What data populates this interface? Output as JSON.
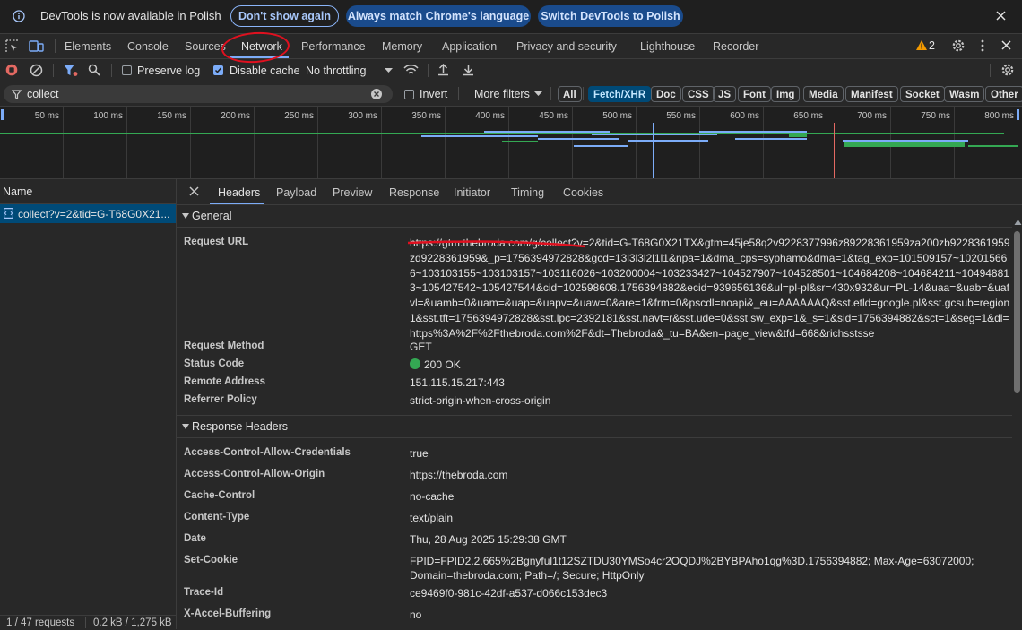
{
  "infobar": {
    "message": "DevTools is now available in Polish",
    "dont_show": "Don't show again",
    "always_match": "Always match Chrome's language",
    "switch_polish": "Switch DevTools to Polish"
  },
  "tabs": [
    "Elements",
    "Console",
    "Sources",
    "Network",
    "Performance",
    "Memory",
    "Application",
    "Privacy and security",
    "Lighthouse",
    "Recorder"
  ],
  "active_tab": "Network",
  "warning_count": "2",
  "toolbar": {
    "preserve_log": "Preserve log",
    "disable_cache": "Disable cache",
    "throttling": "No throttling"
  },
  "filter": {
    "value": "collect",
    "invert": "Invert",
    "more_filters": "More filters",
    "types": [
      "All",
      "Fetch/XHR",
      "Doc",
      "CSS",
      "JS",
      "Font",
      "Img",
      "Media",
      "Manifest",
      "Socket",
      "Wasm",
      "Other"
    ],
    "selected": "Fetch/XHR"
  },
  "timeline": {
    "ticks": [
      "50 ms",
      "100 ms",
      "150 ms",
      "200 ms",
      "250 ms",
      "300 ms",
      "350 ms",
      "400 ms",
      "450 ms",
      "500 ms",
      "550 ms",
      "600 ms",
      "650 ms",
      "700 ms",
      "750 ms",
      "800 ms"
    ]
  },
  "request_list": {
    "header": "Name",
    "item": "collect?v=2&tid=G-T68G0X21...",
    "summary_requests": "1 / 47 requests",
    "summary_size": "0.2 kB / 1,275 kB"
  },
  "detail_tabs": [
    "Headers",
    "Payload",
    "Preview",
    "Response",
    "Initiator",
    "Timing",
    "Cookies"
  ],
  "general": {
    "title": "General",
    "request_url_label": "Request URL",
    "request_url": "https://gtm.thebroda.com/g/collect?v=2&tid=G-T68G0X21TX&gtm=45je58q2v9228377996z89228361959za200zb9228361959zd9228361959&_p=1756394972828&gcd=13l3l3l2l1l1&npa=1&dma_cps=syphamo&dma=1&tag_exp=101509157~102015666~103103155~103103157~103116026~103200004~103233427~104527907~104528501~104684208~104684211~104948813~105427542~105427544&cid=102598608.1756394882&ecid=939656136&ul=pl-pl&sr=430x932&ur=PL-14&uaa=&uab=&uafvl=&uamb=0&uam=&uap=&uapv=&uaw=0&are=1&frm=0&pscdl=noapi&_eu=AAAAAAQ&sst.etld=google.pl&sst.gcsub=region1&sst.tft=1756394972828&sst.lpc=2392181&sst.navt=r&sst.ude=0&sst.sw_exp=1&_s=1&sid=1756394882&sct=1&seg=1&dl=https%3A%2F%2Fthebroda.com%2F&dt=Thebroda&_tu=BA&en=page_view&tfd=668&richsstsse",
    "method_label": "Request Method",
    "method": "GET",
    "status_label": "Status Code",
    "status": "200 OK",
    "remote_label": "Remote Address",
    "remote": "151.115.15.217:443",
    "referrer_label": "Referrer Policy",
    "referrer": "strict-origin-when-cross-origin"
  },
  "response_headers": {
    "title": "Response Headers",
    "rows": [
      {
        "k": "Access-Control-Allow-Credentials",
        "v": "true"
      },
      {
        "k": "Access-Control-Allow-Origin",
        "v": "https://thebroda.com"
      },
      {
        "k": "Cache-Control",
        "v": "no-cache"
      },
      {
        "k": "Content-Type",
        "v": "text/plain"
      },
      {
        "k": "Date",
        "v": "Thu, 28 Aug 2025 15:29:38 GMT"
      },
      {
        "k": "Set-Cookie",
        "v": "FPID=FPID2.2.665%2Bgnyful1t12SZTDU30YMSo4cr2OQDJ%2BYBPAho1qg%3D.1756394882; Max-Age=63072000;",
        "v2": "Domain=thebroda.com; Path=/; Secure; HttpOnly"
      },
      {
        "k": "Trace-Id",
        "v": "ce9469f0-981c-42df-a537-d066c153dec3"
      },
      {
        "k": "X-Accel-Buffering",
        "v": "no"
      }
    ]
  },
  "colors": {
    "accent": "#7cacf8",
    "status_ok": "#34a853",
    "annotation": "#e0101f",
    "selected_row": "#004a77"
  }
}
